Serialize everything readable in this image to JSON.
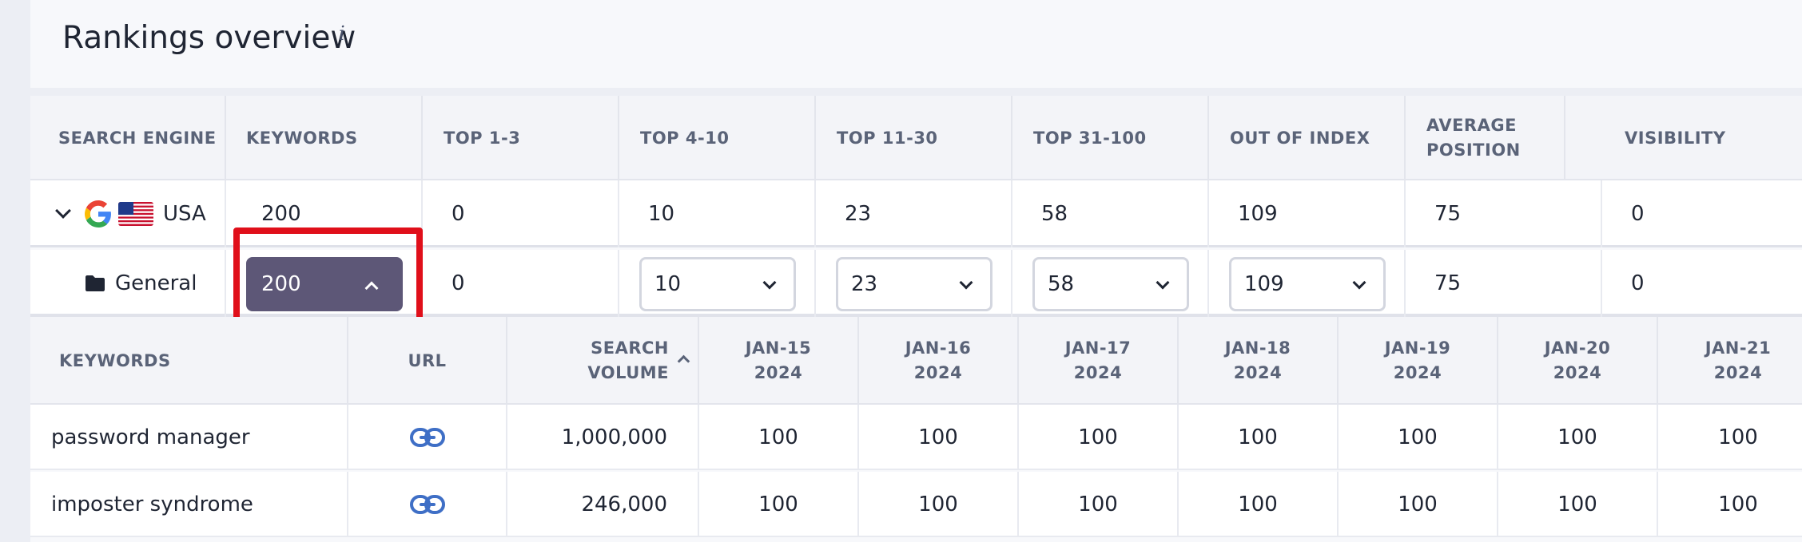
{
  "header": {
    "title": "Rankings overview",
    "info_marker": "i"
  },
  "summary": {
    "columns": [
      "SEARCH ENGINE",
      "KEYWORDS",
      "TOP 1-3",
      "TOP 4-10",
      "TOP 11-30",
      "TOP 31-100",
      "OUT OF INDEX",
      "AVERAGE POSITION",
      "VISIBILITY"
    ],
    "usa": {
      "label": "USA",
      "engine_icon": "google-icon",
      "flag_icon": "us-flag-icon",
      "keywords": "200",
      "top1_3": "0",
      "top4_10": "10",
      "top11_30": "23",
      "top31_100": "58",
      "out_of_index": "109",
      "avg_position": "75",
      "visibility": "0"
    },
    "general": {
      "label": "General",
      "icon": "folder-icon",
      "keywords": "200",
      "top1_3": "0",
      "top4_10": "10",
      "top11_30": "23",
      "top31_100": "58",
      "out_of_index": "109",
      "avg_position": "75",
      "visibility": "0"
    },
    "active_color": "#5d5777",
    "highlight_color": "#e00f1a"
  },
  "keywords_table": {
    "columns": {
      "keywords": "KEYWORDS",
      "url": "URL",
      "search_volume": "SEARCH VOLUME",
      "dates": [
        "JAN-15 2024",
        "JAN-16 2024",
        "JAN-17 2024",
        "JAN-18 2024",
        "JAN-19 2024",
        "JAN-20 2024",
        "JAN-21 2024"
      ]
    },
    "rows": [
      {
        "keyword": "password manager",
        "volume": "1,000,000",
        "positions": [
          "100",
          "100",
          "100",
          "100",
          "100",
          "100",
          "100"
        ]
      },
      {
        "keyword": "imposter syndrome",
        "volume": "246,000",
        "positions": [
          "100",
          "100",
          "100",
          "100",
          "100",
          "100",
          "100"
        ]
      }
    ],
    "link_color": "#3f6fc6"
  }
}
